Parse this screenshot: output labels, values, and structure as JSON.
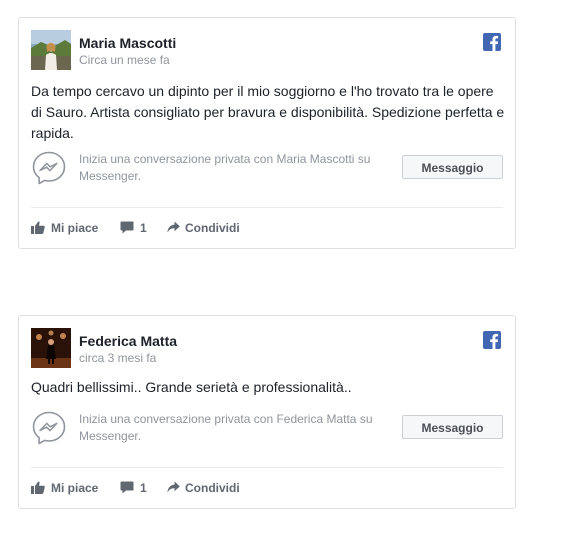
{
  "colors": {
    "facebook_blue": "#4267b2",
    "messenger_gray": "#90949c",
    "text": "#1d2129",
    "muted": "#90949c",
    "border": "#dddfe2"
  },
  "reviews": [
    {
      "author": "Maria Mascotti",
      "time": "Circa un mese fa",
      "text": "Da tempo cercavo un dipinto per il mio soggiorno e l'ho trovato tra le opere di Sauro. Artista consigliato per bravura e disponibilità. Spedizione perfetta e rapida.",
      "messenger_prompt": "Inizia una conversazione privata con Maria Mascotti su Messenger.",
      "message_button": "Messaggio",
      "like_label": "Mi piace",
      "comment_count": "1",
      "share_label": "Condividi",
      "avatar_icon": "profile-photo"
    },
    {
      "author": "Federica Matta",
      "time": "circa 3 mesi fa",
      "text": "Quadri bellissimi.. Grande serietà e professionalità..",
      "messenger_prompt": "Inizia una conversazione privata con Federica Matta su Messenger.",
      "message_button": "Messaggio",
      "like_label": "Mi piace",
      "comment_count": "1",
      "share_label": "Condividi",
      "avatar_icon": "profile-photo"
    }
  ]
}
